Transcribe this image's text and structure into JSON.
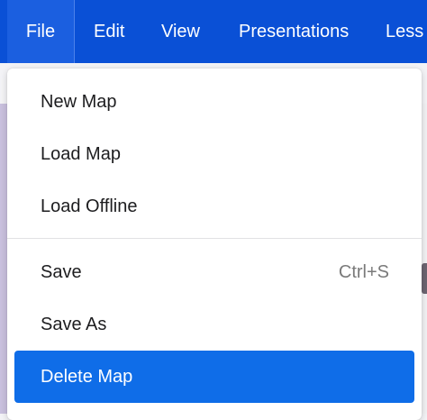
{
  "menubar": {
    "items": [
      {
        "label": "File"
      },
      {
        "label": "Edit"
      },
      {
        "label": "View"
      },
      {
        "label": "Presentations"
      },
      {
        "label": "Less"
      }
    ]
  },
  "file_menu": {
    "items": [
      {
        "label": "New Map"
      },
      {
        "label": "Load Map"
      },
      {
        "label": "Load Offline"
      },
      {
        "label": "Save",
        "shortcut": "Ctrl+S"
      },
      {
        "label": "Save As"
      },
      {
        "label": "Delete Map"
      }
    ]
  },
  "colors": {
    "menubar_bg": "#0a50d6",
    "highlight": "#0f6de8"
  }
}
